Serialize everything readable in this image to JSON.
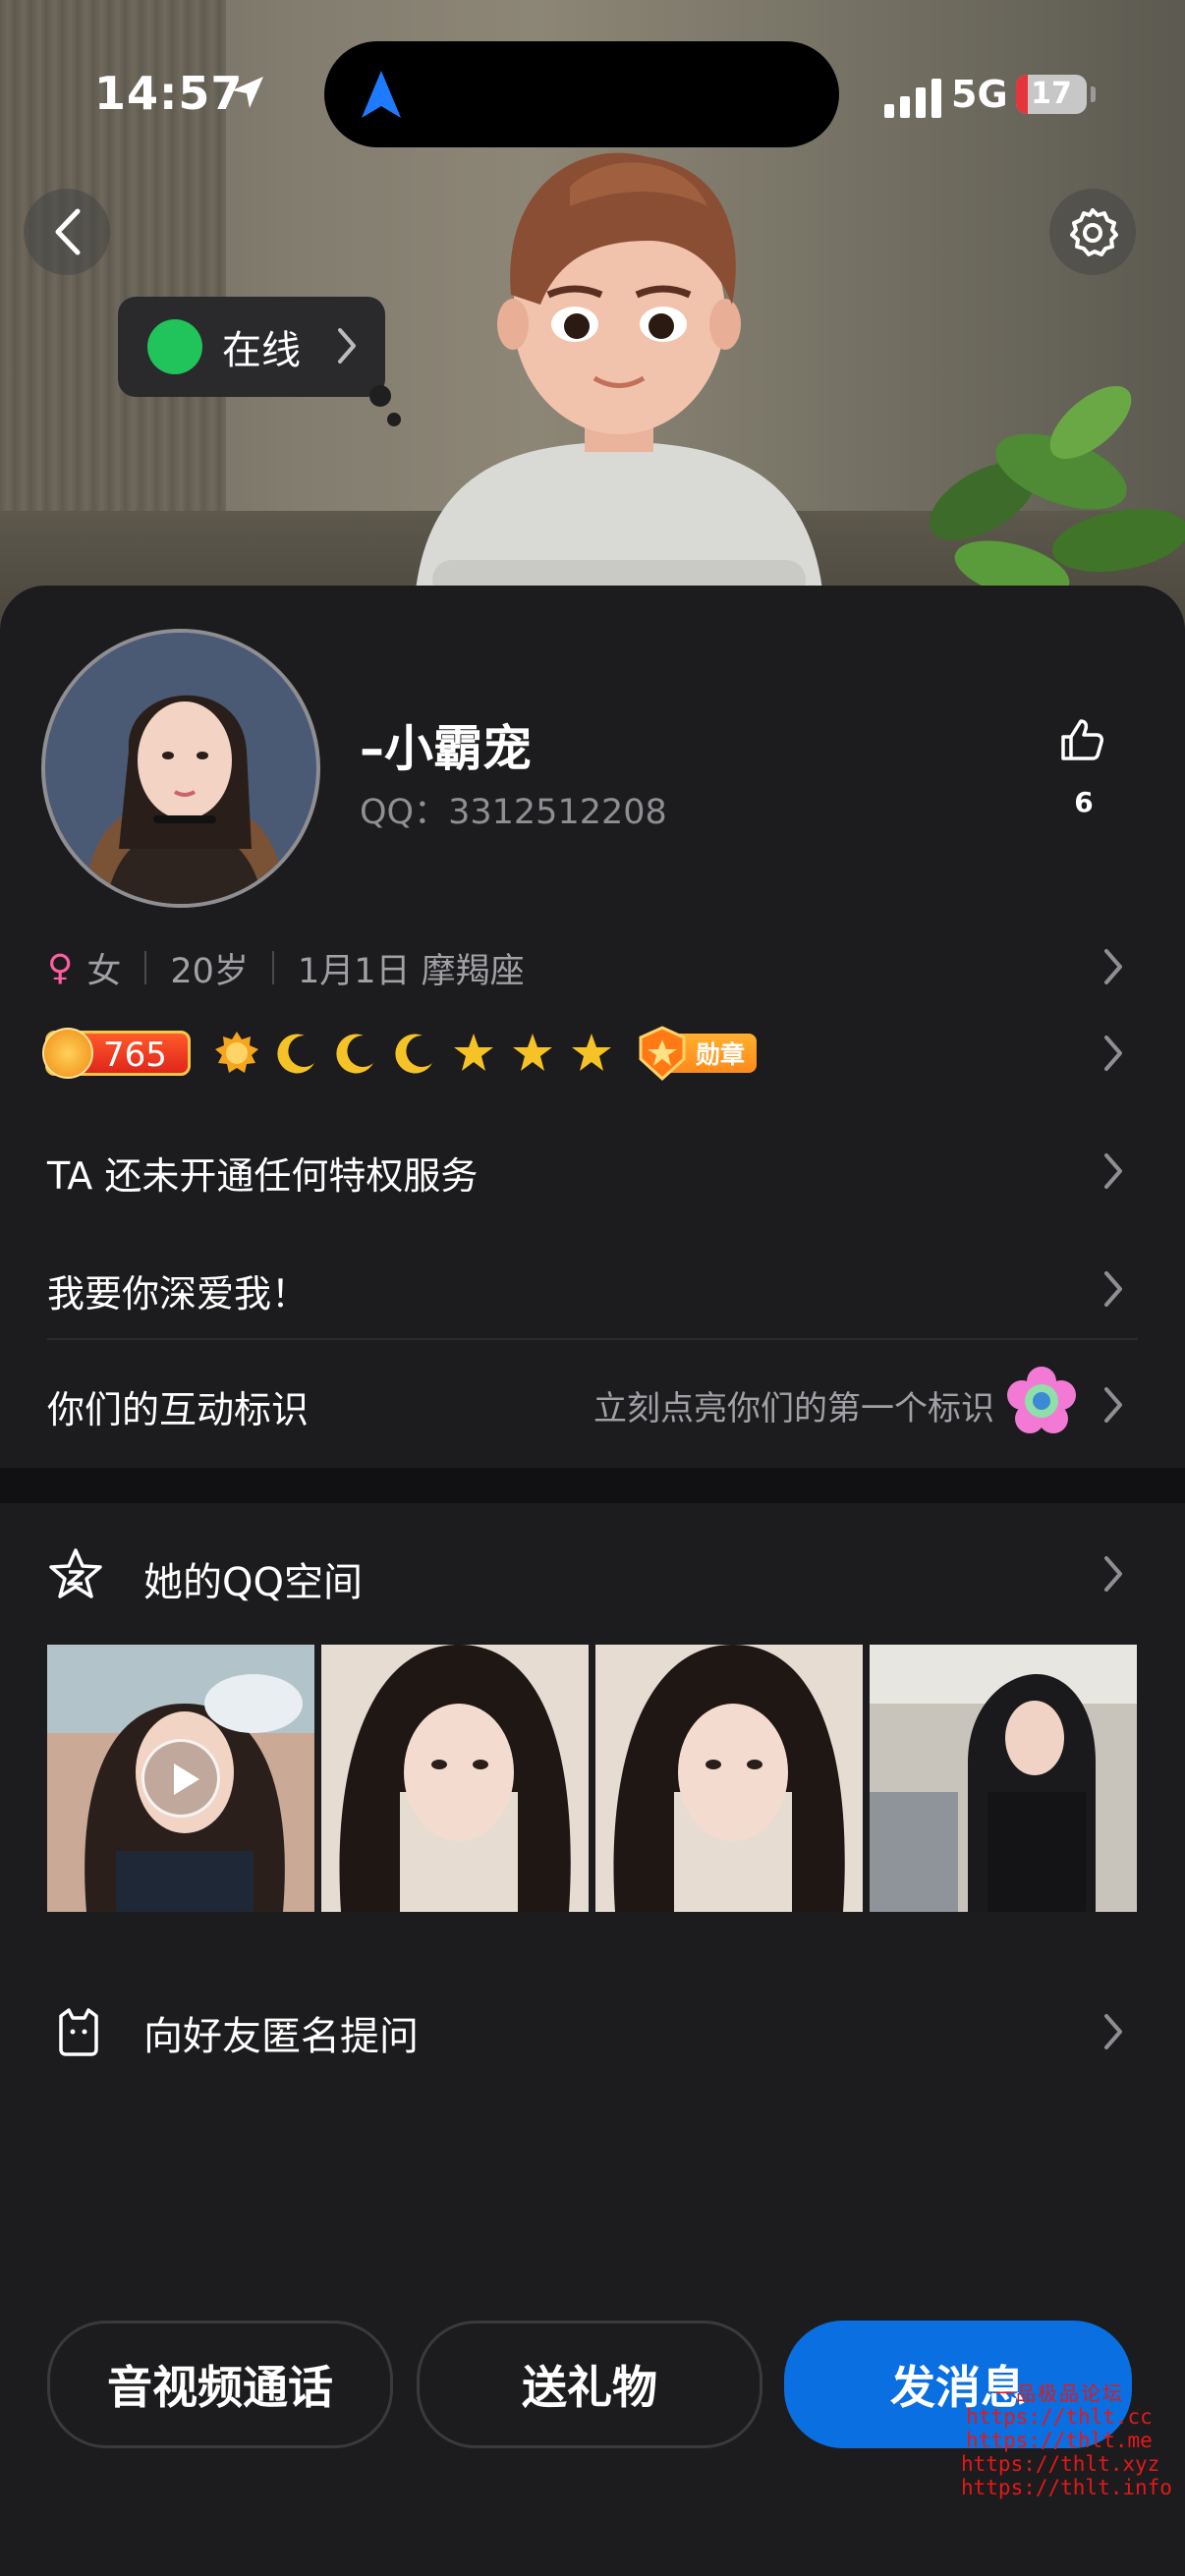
{
  "status_bar": {
    "time": "14:57",
    "network": "5G",
    "battery": "17",
    "battery_level": 0.17
  },
  "hero": {
    "online_status": "在线"
  },
  "profile": {
    "name": "–小霸宠",
    "qq_label": "QQ：3312512208",
    "likes": "6",
    "gender": "女",
    "age": "20岁",
    "birthday": "1月1日 摩羯座",
    "level": "765",
    "medal_label": "勋章"
  },
  "rows": {
    "privilege": "TA 还未开通任何特权服务",
    "signature": "我要你深爱我！",
    "interaction_label": "你们的互动标识",
    "interaction_hint": "立刻点亮你们的第一个标识"
  },
  "qzone": {
    "title": "她的QQ空间"
  },
  "ask": {
    "title": "向好友匿名提问"
  },
  "actions": {
    "call": "音视频通话",
    "gift": "送礼物",
    "message": "发消息"
  },
  "watermark": {
    "title": "一品极品论坛",
    "lines": [
      "https://thlt.cc",
      "https://thlt.me",
      "https://thlt.xyz",
      "https://thlt.info"
    ]
  },
  "colors": {
    "background": "#1c1c1e",
    "primary": "#0a6fe0",
    "online": "#21c35b",
    "female": "#ff5ea5",
    "secondary_text": "#a0a0a5"
  }
}
